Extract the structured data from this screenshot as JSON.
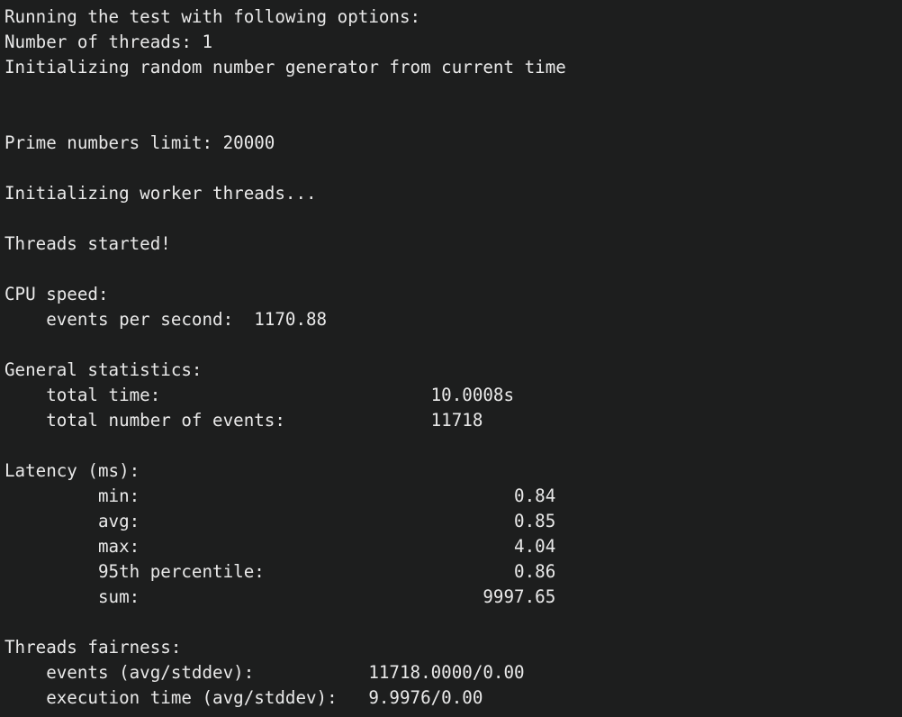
{
  "terminal": {
    "background_color": "#1d1e1e",
    "foreground_color": "#e9e9e9",
    "lines": [
      "Running the test with following options:",
      "Number of threads: 1",
      "Initializing random number generator from current time",
      "",
      "",
      "Prime numbers limit: 20000",
      "",
      "Initializing worker threads...",
      "",
      "Threads started!",
      "",
      "CPU speed:",
      "    events per second:  1170.88",
      "",
      "General statistics:",
      "    total time:                          10.0008s",
      "    total number of events:              11718",
      "",
      "Latency (ms):",
      "         min:                                    0.84",
      "         avg:                                    0.85",
      "         max:                                    4.04",
      "         95th percentile:                        0.86",
      "         sum:                                 9997.65",
      "",
      "Threads fairness:",
      "    events (avg/stddev):           11718.0000/0.00",
      "    execution time (avg/stddev):   9.9976/0.00"
    ],
    "report": {
      "header": {
        "title": "Running the test with following options:",
        "number_of_threads_label": "Number of threads:",
        "number_of_threads_value": "1",
        "rng_init_message": "Initializing random number generator from current time",
        "prime_numbers_limit_label": "Prime numbers limit:",
        "prime_numbers_limit_value": "20000",
        "worker_init_message": "Initializing worker threads...",
        "threads_started_message": "Threads started!"
      },
      "cpu_speed": {
        "section_title": "CPU speed:",
        "events_per_second_label": "events per second:",
        "events_per_second_value": "1170.88"
      },
      "general_statistics": {
        "section_title": "General statistics:",
        "rows": [
          {
            "label": "total time:",
            "value": "10.0008s"
          },
          {
            "label": "total number of events:",
            "value": "11718"
          }
        ]
      },
      "latency": {
        "section_title": "Latency (ms):",
        "rows": [
          {
            "label": "min:",
            "value": "0.84"
          },
          {
            "label": "avg:",
            "value": "0.85"
          },
          {
            "label": "max:",
            "value": "4.04"
          },
          {
            "label": "95th percentile:",
            "value": "0.86"
          },
          {
            "label": "sum:",
            "value": "9997.65"
          }
        ]
      },
      "threads_fairness": {
        "section_title": "Threads fairness:",
        "rows": [
          {
            "label": "events (avg/stddev):",
            "value": "11718.0000/0.00"
          },
          {
            "label": "execution time (avg/stddev):",
            "value": "9.9976/0.00"
          }
        ]
      }
    }
  }
}
